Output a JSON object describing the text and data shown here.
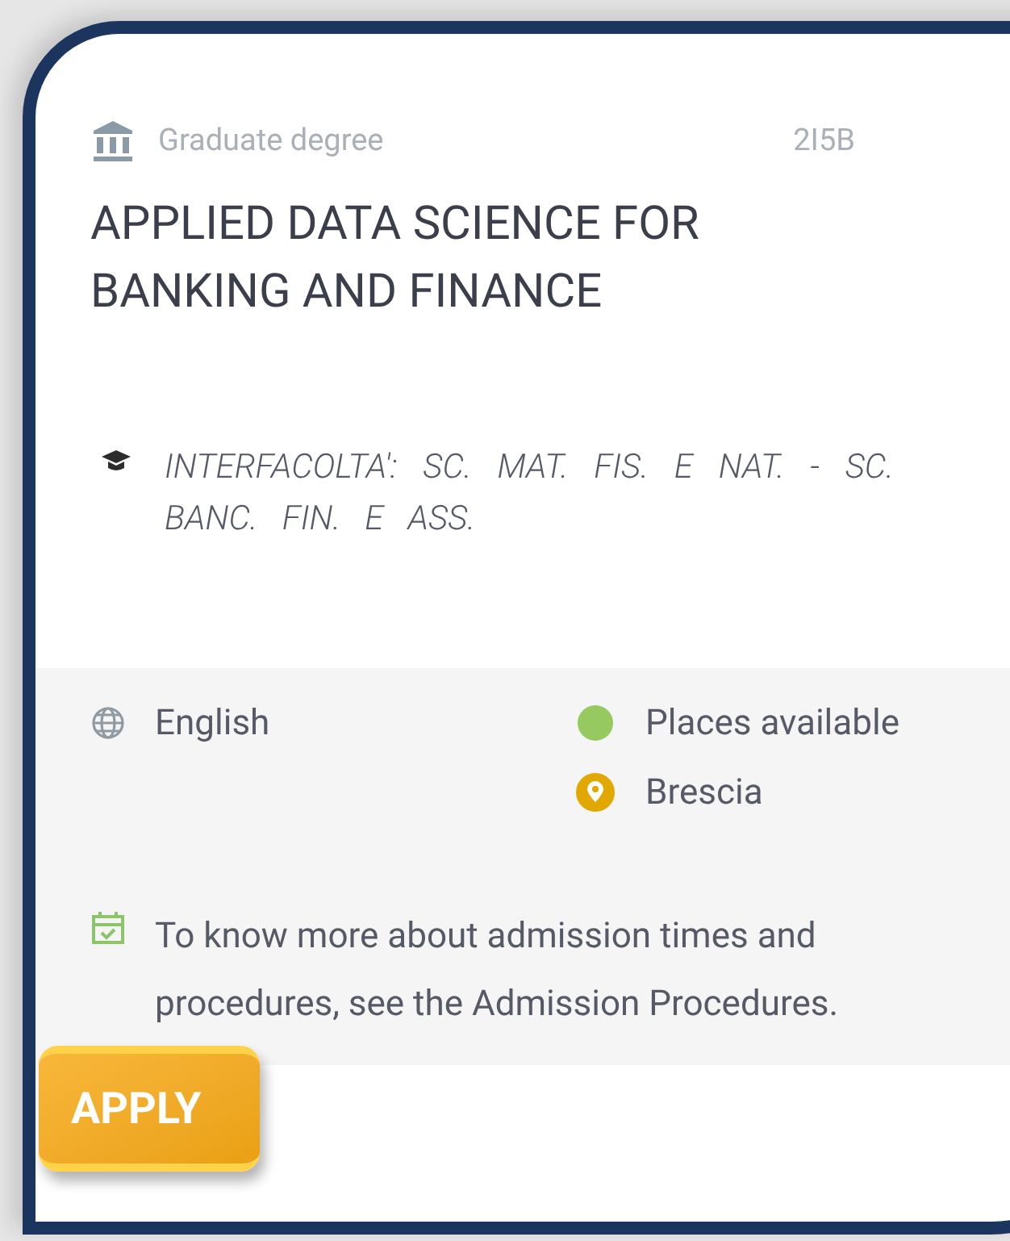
{
  "card": {
    "level_label": "Graduate degree",
    "code": "2I5B",
    "title": "APPLIED DATA SCIENCE FOR BANKING AND FINANCE",
    "faculty": "INTERFACOLTA': SC. MAT. FIS. E NAT. - SC. BANC. FIN. E ASS.",
    "language": "English",
    "availability": {
      "text": "Places available",
      "color": "#96c95f"
    },
    "location": "Brescia",
    "admission_note": "To know more about admission times and procedures, see the Admission Procedures.",
    "apply_button": "APPLY"
  }
}
